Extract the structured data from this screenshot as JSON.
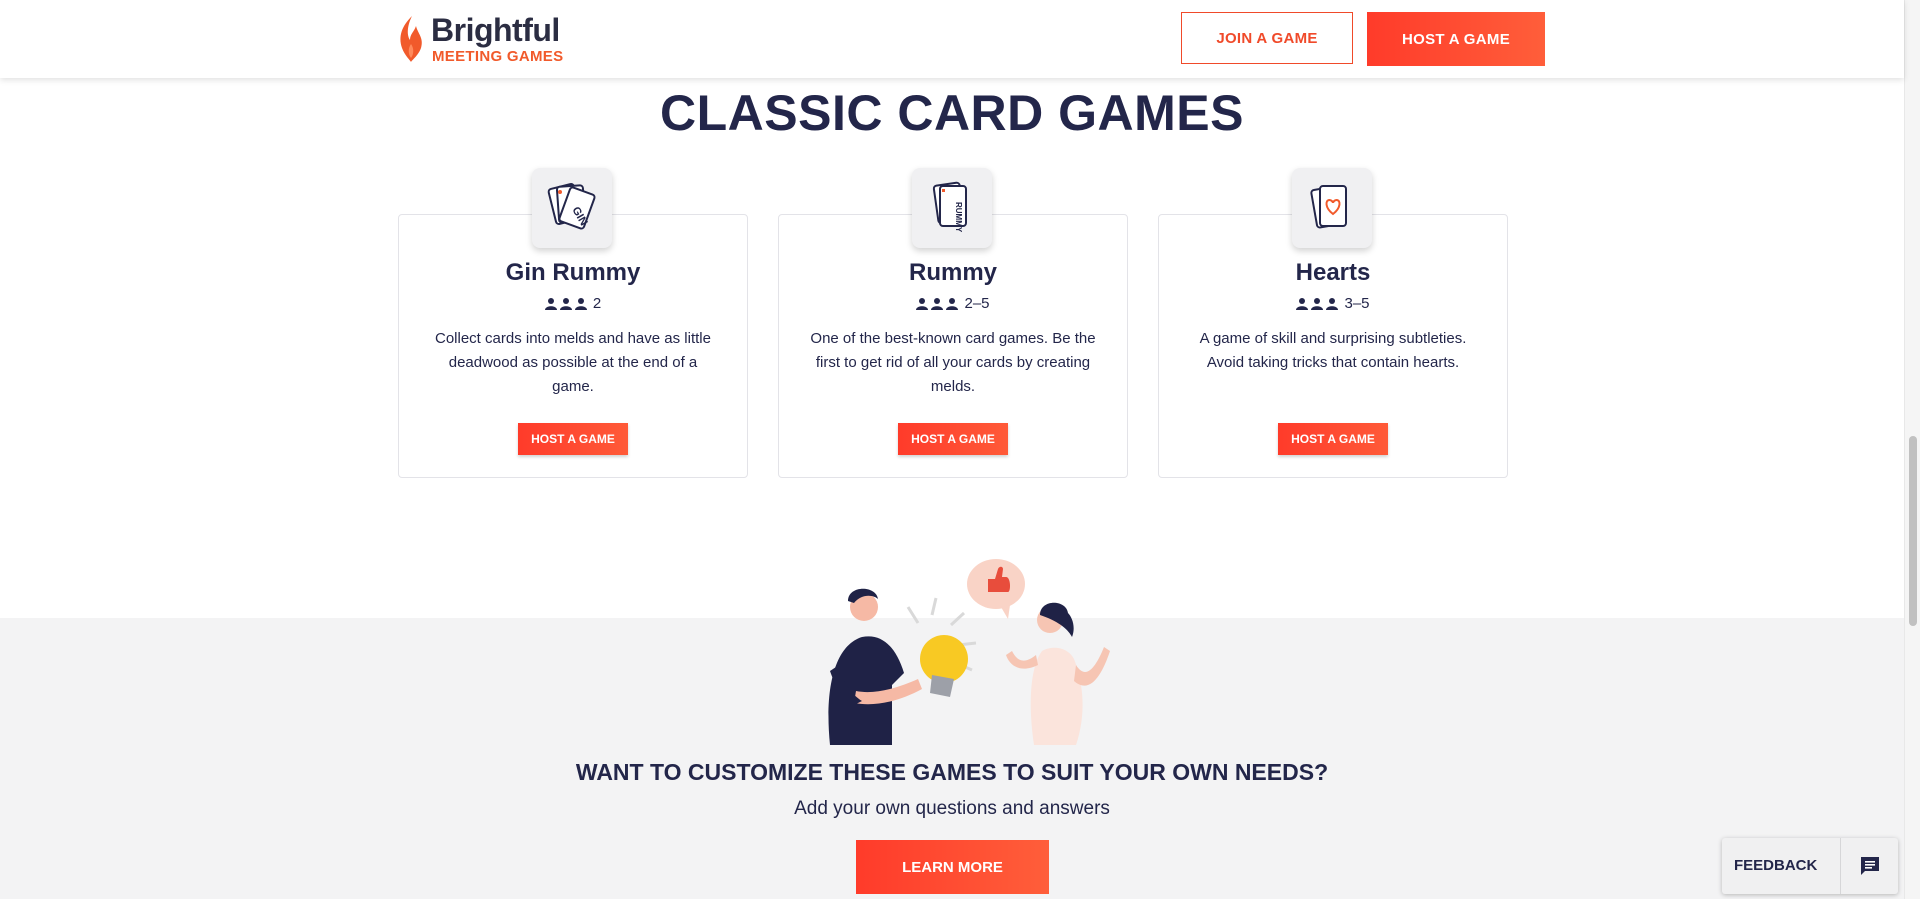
{
  "header": {
    "brand": "Brightful",
    "brand_sub": "MEETING GAMES",
    "join_label": "JOIN A GAME",
    "host_label": "HOST A GAME"
  },
  "section_title": "CLASSIC CARD GAMES",
  "games": [
    {
      "name": "Gin Rummy",
      "players": "2",
      "description": "Collect cards into melds and have as little deadwood as possible at the end of a game.",
      "button": "HOST A GAME",
      "icon": "gin-cards-icon"
    },
    {
      "name": "Rummy",
      "players": "2–5",
      "description": "One of the best-known card games. Be the first to get rid of all your cards by creating melds.",
      "button": "HOST A GAME",
      "icon": "rummy-cards-icon"
    },
    {
      "name": "Hearts",
      "players": "3–5",
      "description": "A game of skill and surprising subtleties. Avoid taking tricks that contain hearts.",
      "button": "HOST A GAME",
      "icon": "heart-cards-icon"
    }
  ],
  "customize": {
    "heading": "WANT TO CUSTOMIZE THESE GAMES TO SUIT YOUR OWN NEEDS?",
    "subheading": "Add your own questions and answers",
    "button": "LEARN MORE"
  },
  "feedback": {
    "label": "FEEDBACK",
    "icon": "chat-icon"
  },
  "colors": {
    "accent": "#ff3b2a",
    "navy": "#23264a",
    "brand_orange": "#f15a2b",
    "bottom_bg": "#f3f3f4"
  }
}
